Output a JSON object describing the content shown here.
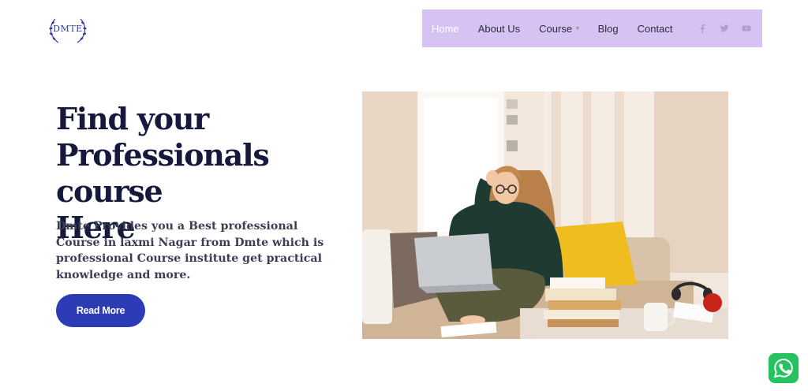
{
  "logo": {
    "text": "DMTE"
  },
  "nav": {
    "items": [
      {
        "label": "Home",
        "active": true
      },
      {
        "label": "About Us",
        "active": false
      },
      {
        "label": "Course",
        "active": false,
        "has_dropdown": true
      },
      {
        "label": "Blog",
        "active": false
      },
      {
        "label": "Contact",
        "active": false
      }
    ],
    "socials": [
      "facebook-icon",
      "twitter-icon",
      "youtube-icon"
    ],
    "background": "#d7c3f3"
  },
  "hero": {
    "title_line1": "Find your",
    "title_line2": "Professionals course",
    "title_line3": "Here",
    "description": "Dmte Provides you a Best professional Course in laxmi Nagar from Dmte which is professional Course institute get practical knowledge and more.",
    "button_label": "Read More",
    "button_color": "#2b3cb4"
  },
  "floating": {
    "whatsapp_icon": "whatsapp-icon",
    "color": "#25c260"
  }
}
